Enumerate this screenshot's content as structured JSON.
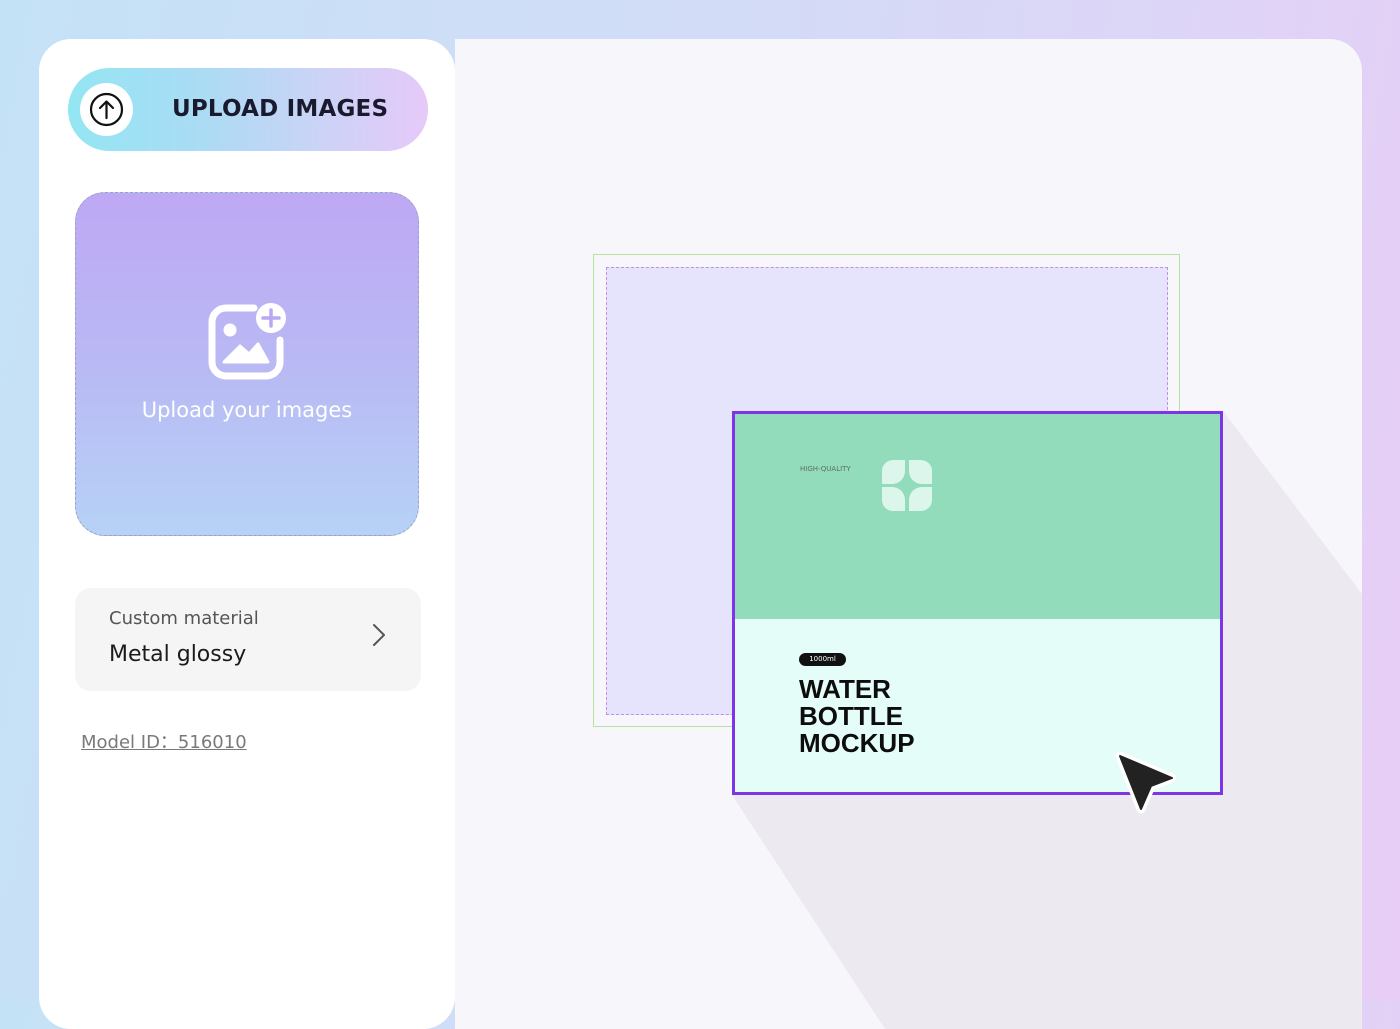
{
  "sidebar": {
    "upload_button_label": "UPLOAD IMAGES",
    "dropzone_text": "Upload your images",
    "material": {
      "title": "Custom material",
      "value": "Metal glossy"
    },
    "model_id": "Model ID：516010"
  },
  "canvas": {
    "product": {
      "quality_label": "HIGH-QUALITY",
      "volume_badge": "1000ml",
      "title_lines": [
        "WATER",
        "BOTTLE",
        "MOCKUP"
      ]
    }
  },
  "colors": {
    "accent_selection": "#7d35e6",
    "product_top": "#93dcbb",
    "product_bottom": "#e4fdf8",
    "frame_outer": "#b7e3a2",
    "frame_inner_dashed": "#c78ce6"
  },
  "icons": {
    "upload": "arrow-up-circle-icon",
    "add_image": "image-plus-icon",
    "chevron": "chevron-right-icon",
    "logo": "clover-logo-icon",
    "cursor": "pointer-cursor-icon"
  }
}
